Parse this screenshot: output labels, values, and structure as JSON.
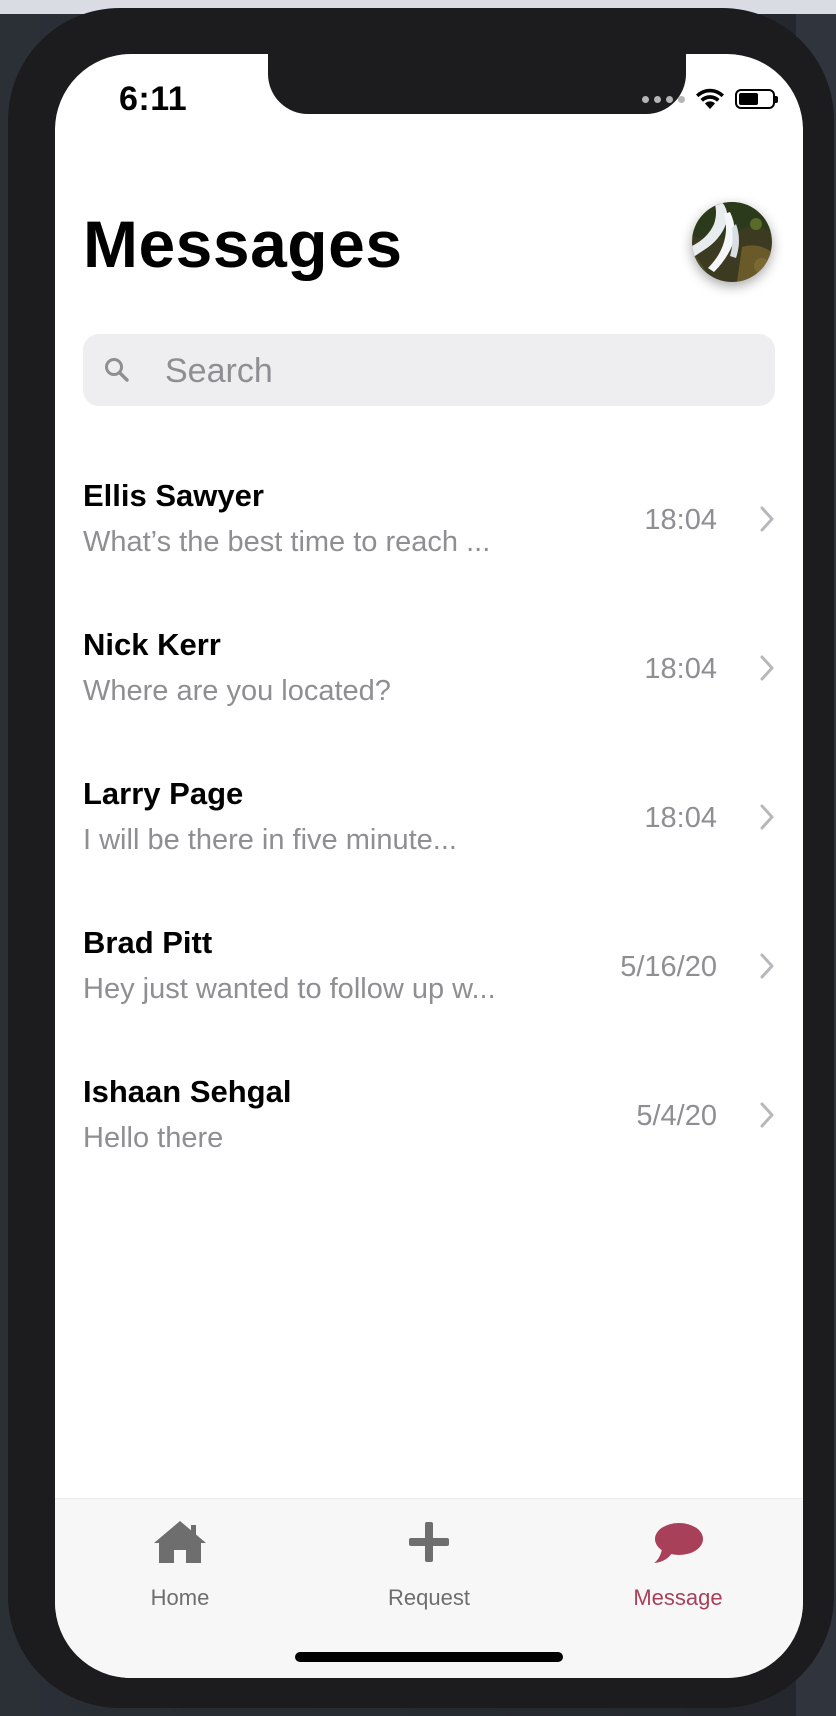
{
  "status_bar": {
    "time": "6:11"
  },
  "header": {
    "title": "Messages",
    "avatar_icon": "waterfall-photo"
  },
  "search": {
    "placeholder": "Search",
    "value": ""
  },
  "messages": [
    {
      "name": "Ellis Sawyer",
      "preview": "What’s the best time to reach ...",
      "time": "18:04"
    },
    {
      "name": "Nick Kerr",
      "preview": "Where are you located?",
      "time": "18:04"
    },
    {
      "name": "Larry Page",
      "preview": "I will be there in five minute...",
      "time": "18:04"
    },
    {
      "name": "Brad Pitt",
      "preview": "Hey just wanted to follow up w...",
      "time": "5/16/20"
    },
    {
      "name": "Ishaan Sehgal",
      "preview": "Hello there",
      "time": "5/4/20"
    }
  ],
  "tabbar": {
    "tabs": [
      {
        "label": "Home",
        "icon": "home-icon",
        "active": false
      },
      {
        "label": "Request",
        "icon": "plus-icon",
        "active": false
      },
      {
        "label": "Message",
        "icon": "chat-bubble-icon",
        "active": true
      }
    ],
    "active_color": "#a8405a",
    "inactive_color": "#6e6e6e"
  }
}
